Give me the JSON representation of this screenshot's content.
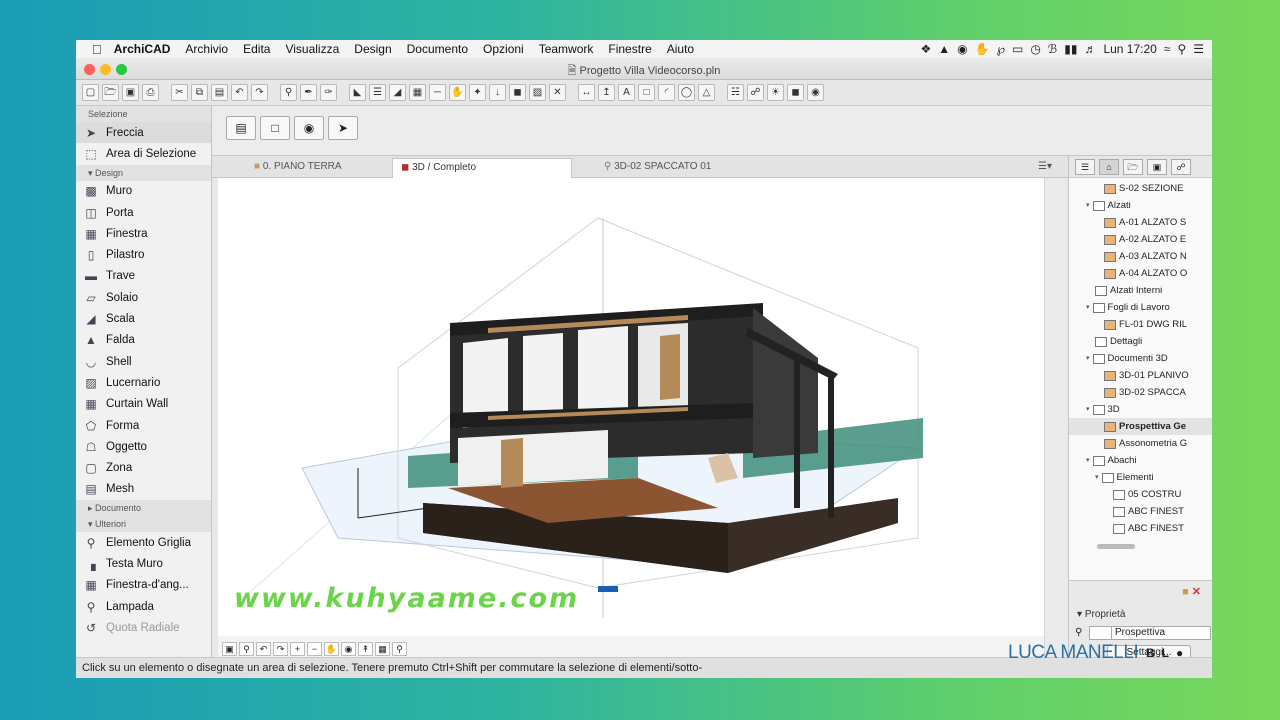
{
  "menubar": {
    "app_name": "ArchiCAD",
    "items": [
      "Archivio",
      "Edita",
      "Visualizza",
      "Design",
      "Documento",
      "Opzioni",
      "Teamwork",
      "Finestre",
      "Aiuto"
    ],
    "clock": "Lun 17:20"
  },
  "window": {
    "title": "Progetto Villa Videocorso.pln"
  },
  "toolbox": {
    "selection_header": "Selezione",
    "selection_tools": [
      {
        "label": "Freccia",
        "icon": "arrow-pointer-icon"
      },
      {
        "label": "Area di Selezione",
        "icon": "marquee-icon"
      }
    ],
    "design_header": "Design",
    "design_tools": [
      {
        "label": "Muro",
        "icon": "wall-icon"
      },
      {
        "label": "Porta",
        "icon": "door-icon"
      },
      {
        "label": "Finestra",
        "icon": "window-icon"
      },
      {
        "label": "Pilastro",
        "icon": "column-icon"
      },
      {
        "label": "Trave",
        "icon": "beam-icon"
      },
      {
        "label": "Solaio",
        "icon": "slab-icon"
      },
      {
        "label": "Scala",
        "icon": "stair-icon"
      },
      {
        "label": "Falda",
        "icon": "roof-icon"
      },
      {
        "label": "Shell",
        "icon": "shell-icon"
      },
      {
        "label": "Lucernario",
        "icon": "skylight-icon"
      },
      {
        "label": "Curtain Wall",
        "icon": "curtain-wall-icon"
      },
      {
        "label": "Forma",
        "icon": "morph-icon"
      },
      {
        "label": "Oggetto",
        "icon": "object-icon"
      },
      {
        "label": "Zona",
        "icon": "zone-icon"
      },
      {
        "label": "Mesh",
        "icon": "mesh-icon"
      }
    ],
    "document_header": "Documento",
    "more_header": "Ulteriori",
    "more_tools": [
      {
        "label": "Elemento Griglia",
        "icon": "grid-element-icon"
      },
      {
        "label": "Testa Muro",
        "icon": "wall-end-icon"
      },
      {
        "label": "Finestra-d'ang...",
        "icon": "corner-window-icon"
      },
      {
        "label": "Lampada",
        "icon": "lamp-icon"
      },
      {
        "label": "Quota Radiale",
        "icon": "radial-dimension-icon"
      }
    ]
  },
  "tabs": [
    {
      "label": "0. PIANO TERRA"
    },
    {
      "label": "3D / Completo"
    },
    {
      "label": "3D-02 SPACCATO 01"
    }
  ],
  "navigator": {
    "items": [
      {
        "label": "S-02 SEZIONE",
        "level": 3
      },
      {
        "label": "Alzati",
        "level": 1
      },
      {
        "label": "A-01 ALZATO S",
        "level": 3
      },
      {
        "label": "A-02 ALZATO E",
        "level": 3
      },
      {
        "label": "A-03 ALZATO N",
        "level": 3
      },
      {
        "label": "A-04 ALZATO O",
        "level": 3
      },
      {
        "label": "Alzati Interni",
        "level": 2
      },
      {
        "label": "Fogli di Lavoro",
        "level": 1
      },
      {
        "label": "FL-01 DWG RIL",
        "level": 3
      },
      {
        "label": "Dettagli",
        "level": 2
      },
      {
        "label": "Documenti 3D",
        "level": 1
      },
      {
        "label": "3D-01 PLANIVO",
        "level": 3
      },
      {
        "label": "3D-02 SPACCA",
        "level": 3
      },
      {
        "label": "3D",
        "level": 1
      },
      {
        "label": "Prospettiva Ge",
        "level": 3
      },
      {
        "label": "Assonometria G",
        "level": 3
      },
      {
        "label": "Abachi",
        "level": 1
      },
      {
        "label": "Elementi",
        "level": 2
      },
      {
        "label": "05 COSTRU",
        "level": 4
      },
      {
        "label": "ABC FINEST",
        "level": 4
      },
      {
        "label": "ABC FINEST",
        "level": 4
      }
    ]
  },
  "properties": {
    "header": "Proprietà",
    "view_name": "Prospettiva",
    "settings_button": "Settaggi..."
  },
  "status_bar": "Click su un elemento o disegnate un area di selezione. Tenere premuto Ctrl+Shift per commutare la selezione di elementi/sotto-",
  "overlay": {
    "watermark": "www.kuhyaame.com",
    "author": "LUCA MANELLI",
    "brand_letters": [
      "B",
      "L"
    ]
  },
  "colors": {
    "background_left": "#1a9cb6",
    "background_right": "#7ad85a",
    "watermark": "#6cd44a",
    "author": "#2c6fa4"
  }
}
